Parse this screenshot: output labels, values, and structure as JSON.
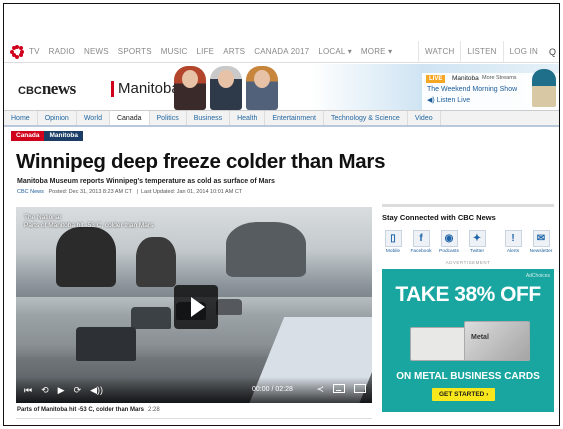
{
  "nav": {
    "items": [
      "TV",
      "RADIO",
      "NEWS",
      "SPORTS",
      "MUSIC",
      "LIFE",
      "ARTS",
      "CANADA 2017",
      "LOCAL ▾",
      "MORE ▾"
    ],
    "right": [
      "WATCH",
      "LISTEN",
      "LOG IN"
    ],
    "search_glyph": "Q"
  },
  "header": {
    "logo_main": "CBC",
    "logo_news": "news",
    "region": "Manitoba"
  },
  "live": {
    "badge": "LIVE",
    "region": "Manitoba",
    "more": "More Streams",
    "show": "The Weekend Morning Show",
    "listen": "◀) Listen Live"
  },
  "sections": [
    "Home",
    "Opinion",
    "World",
    "Canada",
    "Politics",
    "Business",
    "Health",
    "Entertainment",
    "Technology & Science",
    "Video"
  ],
  "active_section": "Canada",
  "breadcrumb": [
    "Canada",
    "Manitoba"
  ],
  "article": {
    "headline": "Winnipeg deep freeze colder than Mars",
    "subhead": "Manitoba Museum reports Winnipeg's temperature as cold as surface of Mars",
    "source": "CBC News",
    "posted": "Posted: Dec 31, 2013 8:23 AM CT",
    "updated": "Last Updated: Jan 01, 2014 10:01 AM CT"
  },
  "video": {
    "program": "The National",
    "title": "Parts of Manitoba hit -53 C, colder than Mars",
    "time": "00:00 / 02:28",
    "caption": "Parts of Manitoba hit -53 C, colder than Mars",
    "duration": "2:28",
    "controls": {
      "rewind": "⏮",
      "back": "⟲",
      "play": "▶",
      "forward": "⟳",
      "volume": "◀))",
      "share": "≺"
    }
  },
  "sidebar": {
    "title": "Stay Connected with CBC News",
    "social": [
      {
        "icon": "mobile-icon",
        "glyph": "▯",
        "label": "Mobile"
      },
      {
        "icon": "facebook-icon",
        "glyph": "f",
        "label": "Facebook"
      },
      {
        "icon": "podcasts-icon",
        "glyph": "◉",
        "label": "Podcasts"
      },
      {
        "icon": "twitter-icon",
        "glyph": "✦",
        "label": "Twitter"
      },
      {
        "icon": "alerts-icon",
        "glyph": "!",
        "label": "Alerts"
      },
      {
        "icon": "newsletter-icon",
        "glyph": "✉",
        "label": "Newsletter"
      }
    ],
    "ad_label": "ADVERTISEMENT",
    "ad": {
      "headline": "TAKE 38% OFF",
      "brand": "Metal",
      "sub": "ON METAL BUSINESS CARDS",
      "cta": "GET STARTED ›",
      "tag": "AdChoices"
    }
  },
  "colors": {
    "cbc_red": "#d0021b",
    "link_blue": "#1a5c9a",
    "ad_teal": "#19a6a0",
    "cta_yellow": "#f8e71c"
  }
}
